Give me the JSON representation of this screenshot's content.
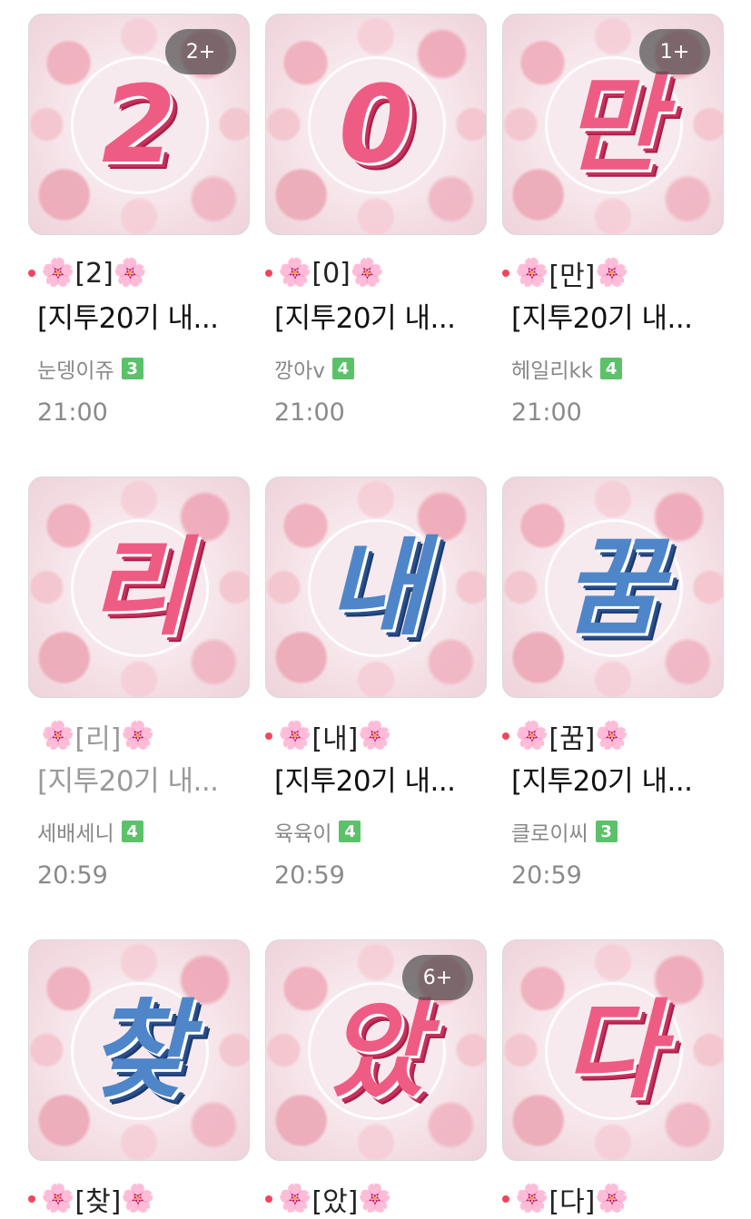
{
  "posts": [
    {
      "glyph": "2",
      "color": "pink",
      "badge": "2+",
      "title_mark": "[2]",
      "subtitle": "[지투20기 내...",
      "author": "눈뎅이쥬",
      "level": "3",
      "time": "21:00"
    },
    {
      "glyph": "0",
      "color": "pink",
      "badge": "",
      "title_mark": "[0]",
      "subtitle": "[지투20기 내...",
      "author": "깡아v",
      "level": "4",
      "time": "21:00"
    },
    {
      "glyph": "만",
      "color": "pink",
      "badge": "1+",
      "title_mark": "[만]",
      "subtitle": "[지투20기 내...",
      "author": "헤일리kk",
      "level": "4",
      "time": "21:00"
    },
    {
      "glyph": "리",
      "color": "pink",
      "badge": "",
      "title_mark": "[리]",
      "subtitle": "[지투20기 내...",
      "author": "세배세니",
      "level": "4",
      "time": "20:59"
    },
    {
      "glyph": "내",
      "color": "blue",
      "badge": "",
      "title_mark": "[내]",
      "subtitle": "[지투20기 내...",
      "author": "육육이",
      "level": "4",
      "time": "20:59"
    },
    {
      "glyph": "꿈",
      "color": "blue",
      "badge": "",
      "title_mark": "[꿈]",
      "subtitle": "[지투20기 내...",
      "author": "클로이씨",
      "level": "3",
      "time": "20:59"
    },
    {
      "glyph": "찾",
      "color": "blue",
      "badge": "",
      "title_mark": "[찾]",
      "subtitle": "",
      "author": "",
      "level": "",
      "time": ""
    },
    {
      "glyph": "았",
      "color": "pink",
      "badge": "6+",
      "title_mark": "[았]",
      "subtitle": "",
      "author": "",
      "level": "",
      "time": ""
    },
    {
      "glyph": "다",
      "color": "pink",
      "badge": "",
      "title_mark": "[다]",
      "subtitle": "",
      "author": "",
      "level": "",
      "time": ""
    }
  ],
  "flower_symbol": "🌸"
}
